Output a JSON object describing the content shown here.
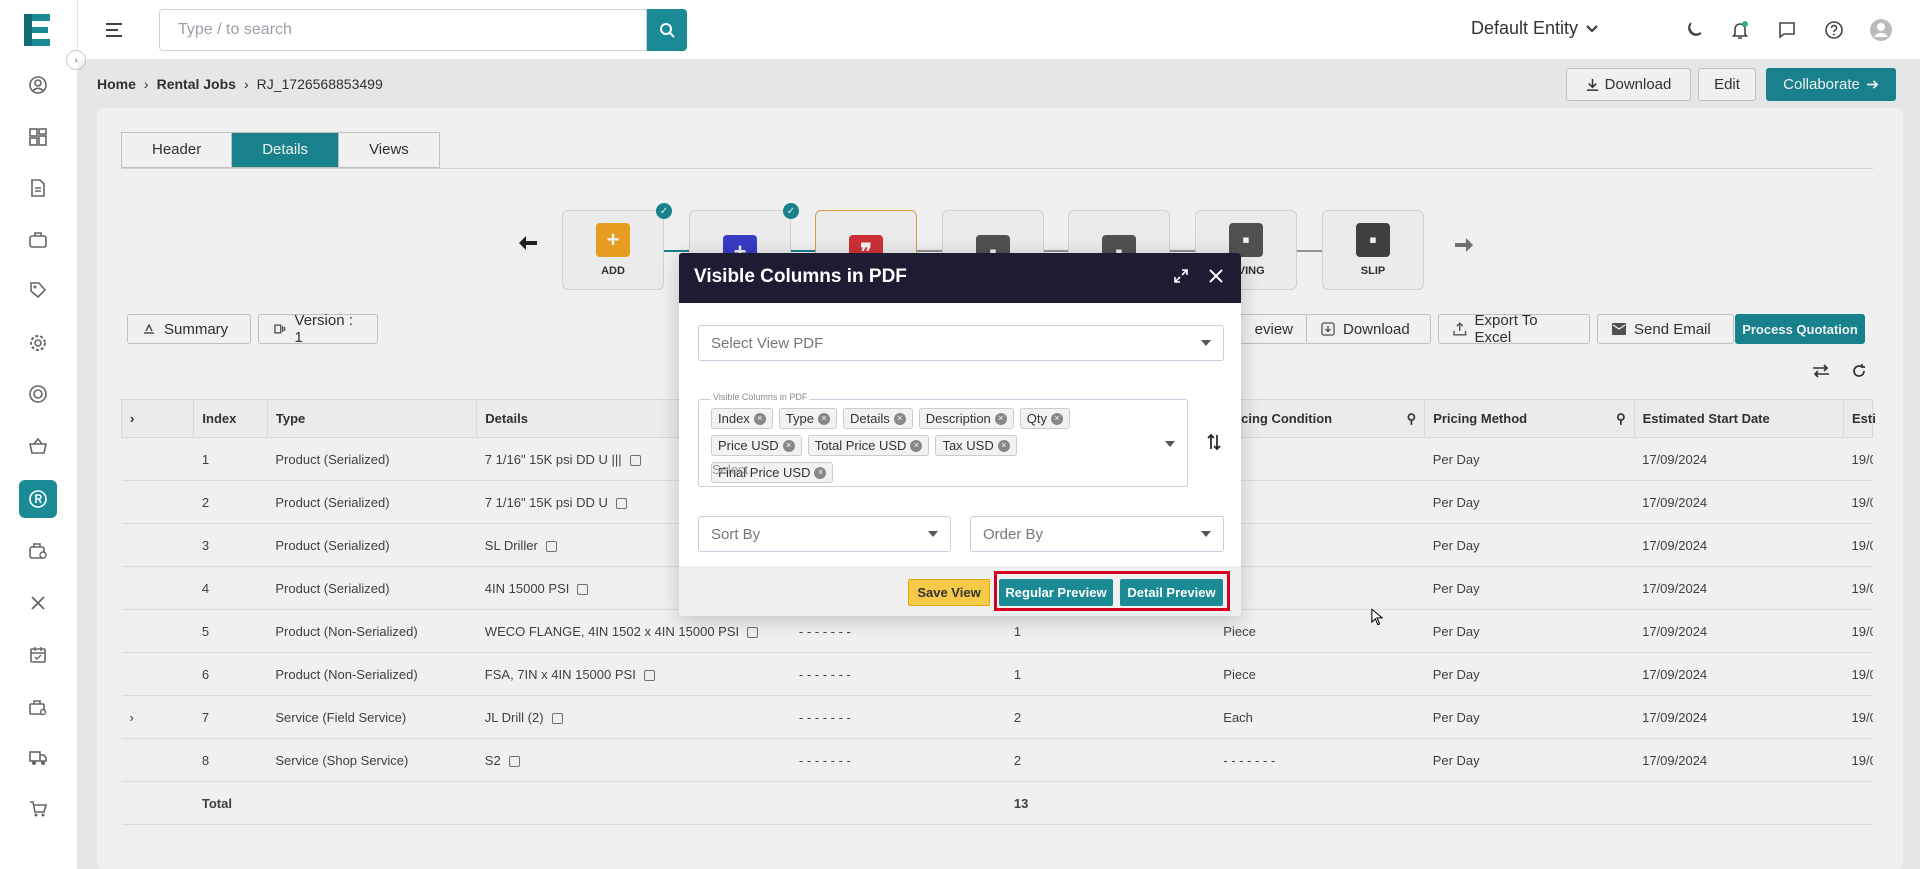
{
  "app": {
    "logo": "E"
  },
  "sidebar": {
    "icons": [
      "user-circle-icon",
      "dashboard-icon",
      "document-icon",
      "briefcase-icon",
      "tag-icon",
      "gear-icon",
      "target-icon",
      "basket-icon",
      "rental-icon",
      "briefcase-clock-icon",
      "tools-icon",
      "calendar-icon",
      "toolbox-icon",
      "truck-icon",
      "cart-icon"
    ],
    "active_index": 8
  },
  "topbar": {
    "search_placeholder": "Type / to search",
    "entity": "Default Entity"
  },
  "breadcrumb": {
    "home": "Home",
    "section": "Rental Jobs",
    "current": "RJ_1726568853499"
  },
  "header_actions": {
    "download": "Download",
    "edit": "Edit",
    "collaborate": "Collaborate"
  },
  "tabs": [
    {
      "label": "Header"
    },
    {
      "label": "Details"
    },
    {
      "label": "Views"
    }
  ],
  "workflow": {
    "steps": [
      {
        "label": "ADD",
        "color": "#f5a623",
        "done": true
      },
      {
        "label": "",
        "color": "#3c3fd1",
        "done": true
      },
      {
        "label": "",
        "color": "#d9343a",
        "done": false
      },
      {
        "label": "",
        "color": "#555555",
        "done": false
      },
      {
        "label": "",
        "color": "#555555",
        "done": false
      },
      {
        "label": "EIVING",
        "color": "#555555",
        "done": false
      },
      {
        "label": "SLIP",
        "color": "#444444",
        "done": false
      }
    ]
  },
  "toolbar": {
    "summary": "Summary",
    "version": "Version : 1",
    "preview_partial": "eview",
    "download": "Download",
    "export": "Export To Excel",
    "send_email": "Send Email",
    "process": "Process Quotation"
  },
  "table": {
    "headers": {
      "index": "Index",
      "type": "Type",
      "details": "Details",
      "pricing_condition": "Pricing Condition",
      "pricing_method": "Pricing Method",
      "start_date": "Estimated Start Date",
      "next": "Esti"
    },
    "rows": [
      {
        "index": "1",
        "type": "Product (Serialized)",
        "details": "7 1/16\" 15K psi DD U |||",
        "desc": "",
        "qty": "",
        "uom": "",
        "cond": "- - - - - - -",
        "method": "Per Day",
        "start": "17/09/2024",
        "next": "19/0"
      },
      {
        "index": "2",
        "type": "Product (Serialized)",
        "details": "7 1/16\" 15K psi DD U",
        "desc": "",
        "qty": "",
        "uom": "",
        "cond": "- - - - - - -",
        "method": "Per Day",
        "start": "17/09/2024",
        "next": "19/0"
      },
      {
        "index": "3",
        "type": "Product (Serialized)",
        "details": "SL Driller",
        "desc": "",
        "qty": "",
        "uom": "",
        "cond": "- - - - - - -",
        "method": "Per Day",
        "start": "17/09/2024",
        "next": "19/0"
      },
      {
        "index": "4",
        "type": "Product (Serialized)",
        "details": "4IN 15000 PSI",
        "desc": "",
        "qty": "",
        "uom": "",
        "cond": "- - - - - - -",
        "method": "Per Day",
        "start": "17/09/2024",
        "next": "19/0"
      },
      {
        "index": "5",
        "type": "Product (Non-Serialized)",
        "details": "WECO FLANGE, 4IN 1502 x 4IN 15000 PSI",
        "desc": "- - - - - - -",
        "qty": "1",
        "uom": "Piece",
        "cond": "- - - - - - -",
        "method": "Per Day",
        "start": "17/09/2024",
        "next": "19/0"
      },
      {
        "index": "6",
        "type": "Product (Non-Serialized)",
        "details": "FSA, 7IN x 4IN 15000 PSI",
        "desc": "- - - - - - -",
        "qty": "1",
        "uom": "Piece",
        "cond": "- - - - - - -",
        "method": "Per Day",
        "start": "17/09/2024",
        "next": "19/0"
      },
      {
        "index": "7",
        "type": "Service (Field Service)",
        "details": "JL Drill (2)",
        "desc": "- - - - - - -",
        "qty": "2",
        "uom": "Each",
        "cond": "- - - - - - -",
        "method": "Per Day",
        "start": "17/09/2024",
        "next": "19/0"
      },
      {
        "index": "8",
        "type": "Service (Shop Service)",
        "details": "S2",
        "desc": "- - - - - - -",
        "qty": "2",
        "uom": "- - - - - - -",
        "cond": "- - - - - - -",
        "method": "Per Day",
        "start": "17/09/2024",
        "next": "19/0"
      }
    ],
    "total_label": "Total",
    "total_qty": "13"
  },
  "modal": {
    "title": "Visible Columns in PDF",
    "select_view_placeholder": "Select View PDF",
    "columns_label": "Visible Columns in PDF",
    "chips": [
      "Index",
      "Type",
      "Details",
      "Description",
      "Qty",
      "Price USD",
      "Total Price USD",
      "Tax USD",
      "Final Price USD"
    ],
    "select_placeholder": "Select",
    "sort_by": "Sort By",
    "order_by": "Order By",
    "save_view": "Save View",
    "regular_preview": "Regular Preview",
    "detail_preview": "Detail Preview"
  },
  "colors": {
    "accent": "#1a8a95",
    "modal_header": "#1d1c33",
    "save_view": "#f7c948",
    "highlight": "#d4001f"
  }
}
